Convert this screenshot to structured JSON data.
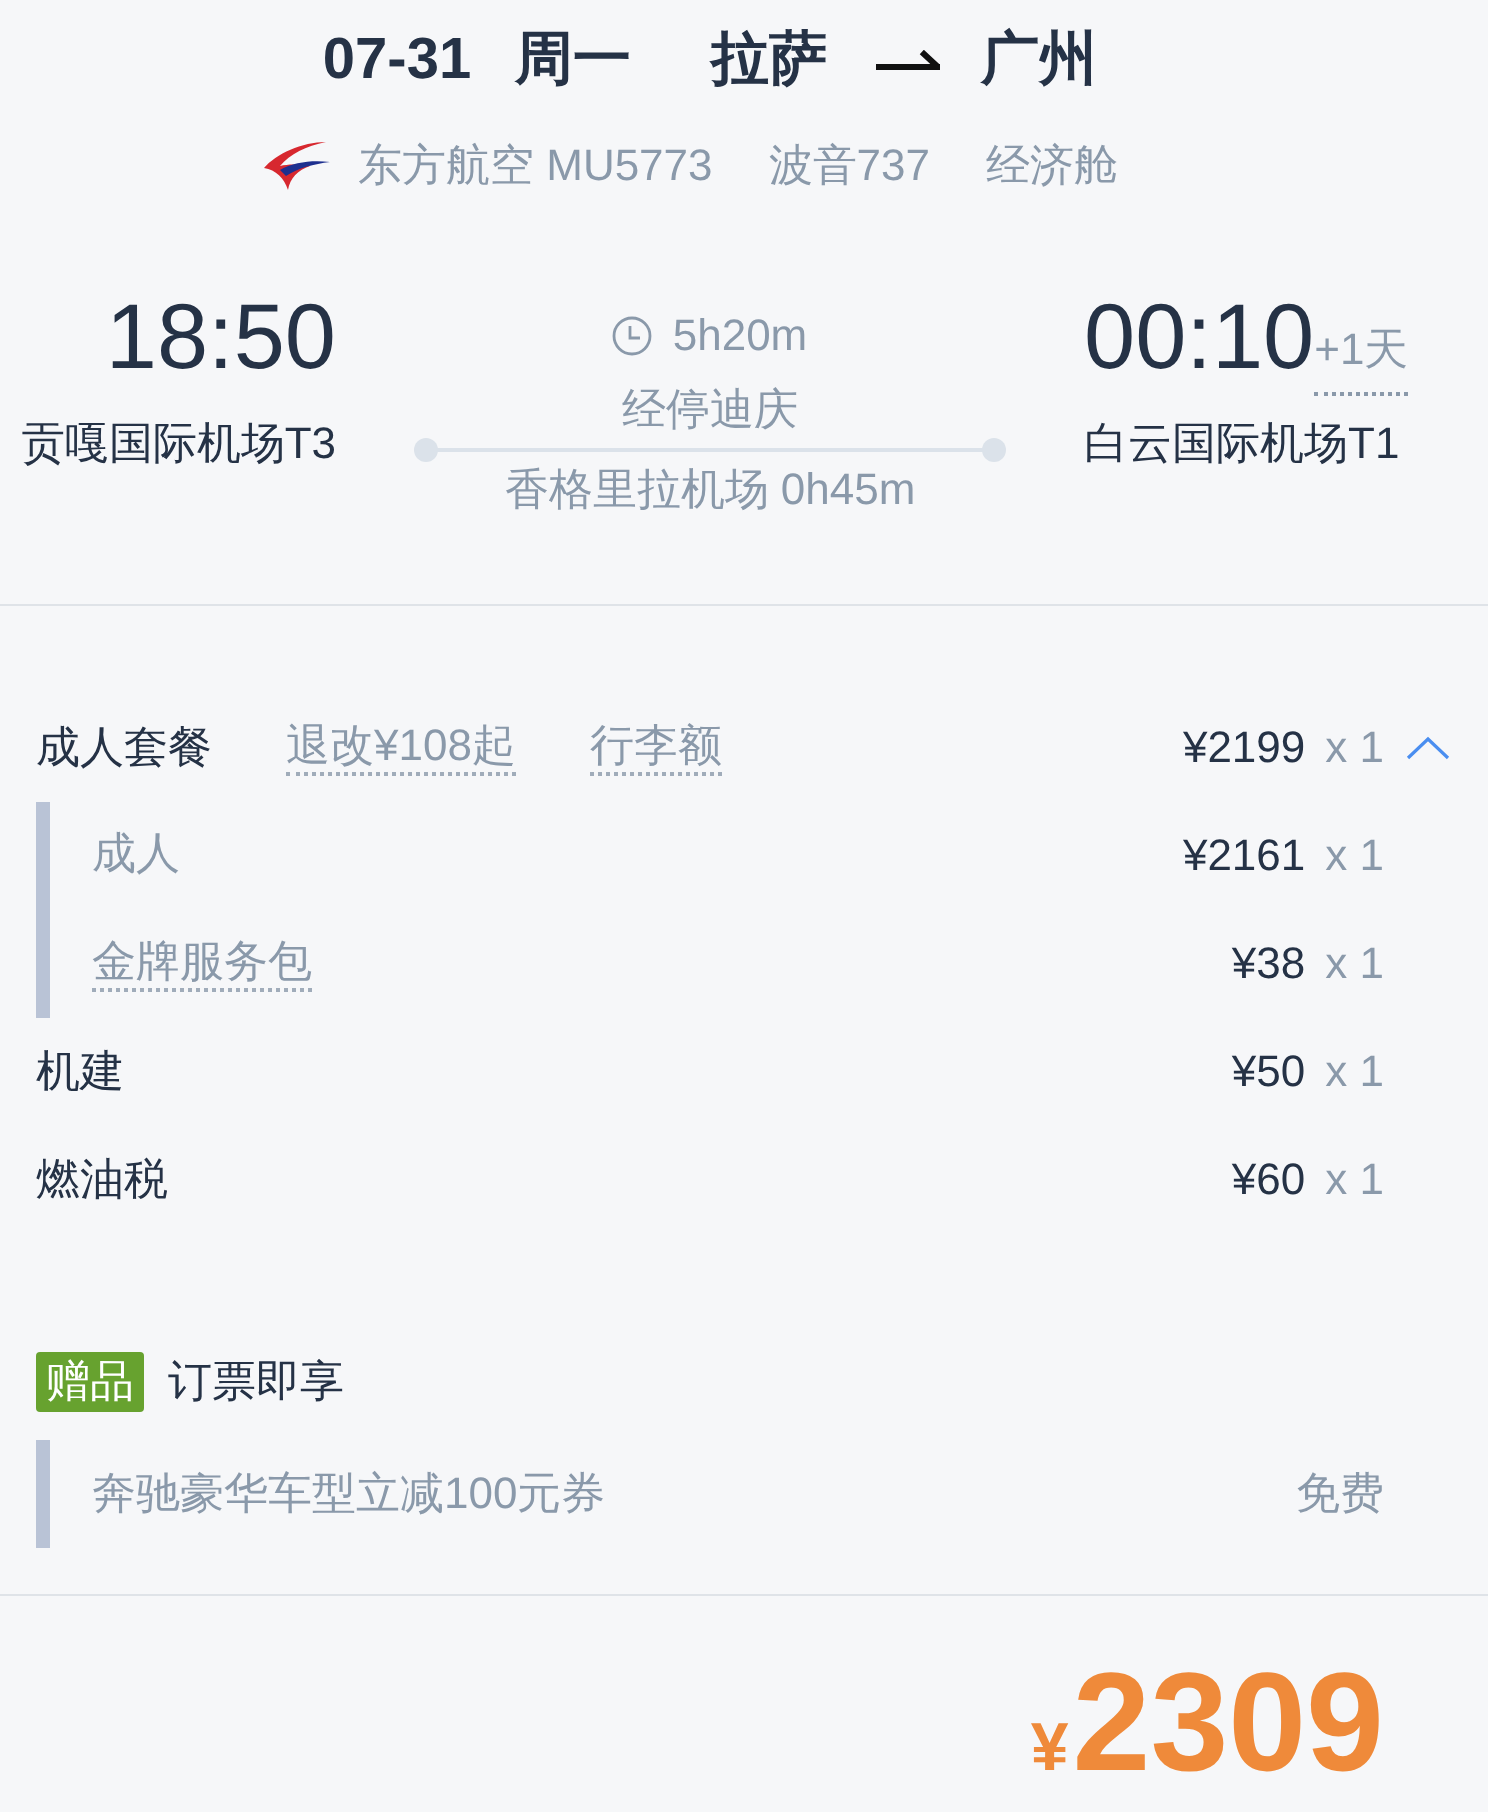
{
  "header": {
    "date": "07-31",
    "weekday": "周一",
    "origin": "拉萨",
    "destination": "广州"
  },
  "flight_info": {
    "airline_flight": "东方航空 MU5773",
    "aircraft": "波音737",
    "cabin": "经济舱"
  },
  "departure": {
    "time": "18:50",
    "airport": "贡嘎国际机场T3"
  },
  "journey": {
    "duration": "5h20m",
    "stopover": "经停迪庆",
    "stopover_airport": "香格里拉机场 0h45m"
  },
  "arrival": {
    "time": "00:10",
    "day_offset": "+1天",
    "airport": "白云国际机场T1"
  },
  "price_items": [
    {
      "kind": "package",
      "name": "成人套餐",
      "links": [
        "退改¥108起",
        "行李额"
      ],
      "price": "¥2199",
      "quantity": "x 1",
      "expanded": true,
      "children": [
        {
          "name": "成人",
          "price": "¥2161",
          "quantity": "x 1",
          "has_info": false
        },
        {
          "name": "金牌服务包",
          "price": "¥38",
          "quantity": "x 1",
          "has_info": true
        }
      ]
    },
    {
      "kind": "fee",
      "name": "机建",
      "price": "¥50",
      "quantity": "x 1"
    },
    {
      "kind": "fee",
      "name": "燃油税",
      "price": "¥60",
      "quantity": "x 1"
    }
  ],
  "gift": {
    "badge": "赠品",
    "title": "订票即享",
    "items": [
      {
        "name": "奔驰豪华车型立减100元券",
        "price": "免费"
      }
    ]
  },
  "total": {
    "currency": "¥",
    "amount": "2309"
  }
}
